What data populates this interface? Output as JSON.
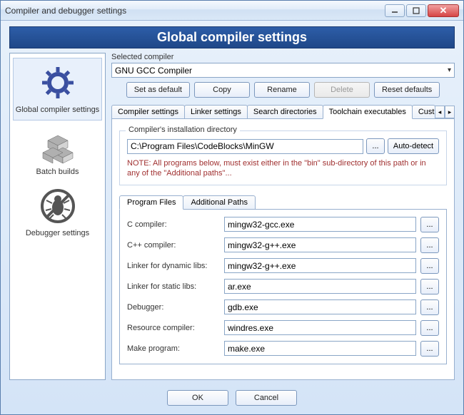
{
  "window": {
    "title": "Compiler and debugger settings"
  },
  "banner": "Global compiler settings",
  "sidebar": {
    "items": [
      {
        "label": "Global compiler settings"
      },
      {
        "label": "Batch builds"
      },
      {
        "label": "Debugger settings"
      }
    ]
  },
  "selected_compiler_label": "Selected compiler",
  "selected_compiler_value": "GNU GCC Compiler",
  "compiler_buttons": {
    "set_default": "Set as default",
    "copy": "Copy",
    "rename": "Rename",
    "delete": "Delete",
    "reset": "Reset defaults"
  },
  "tabs": [
    "Compiler settings",
    "Linker settings",
    "Search directories",
    "Toolchain executables",
    "Custom va"
  ],
  "toolchain": {
    "groupbox_title": "Compiler's installation directory",
    "path": "C:\\Program Files\\CodeBlocks\\MinGW",
    "browse": "...",
    "auto_detect": "Auto-detect",
    "note": "NOTE: All programs below, must exist either in the \"bin\" sub-directory of this path or in any of the \"Additional paths\"...",
    "inner_tabs": [
      "Program Files",
      "Additional Paths"
    ],
    "fields": [
      {
        "label": "C compiler:",
        "value": "mingw32-gcc.exe"
      },
      {
        "label": "C++ compiler:",
        "value": "mingw32-g++.exe"
      },
      {
        "label": "Linker for dynamic libs:",
        "value": "mingw32-g++.exe"
      },
      {
        "label": "Linker for static libs:",
        "value": "ar.exe"
      },
      {
        "label": "Debugger:",
        "value": "gdb.exe"
      },
      {
        "label": "Resource compiler:",
        "value": "windres.exe"
      },
      {
        "label": "Make program:",
        "value": "make.exe"
      }
    ],
    "browse_ellipsis": "..."
  },
  "footer": {
    "ok": "OK",
    "cancel": "Cancel"
  }
}
